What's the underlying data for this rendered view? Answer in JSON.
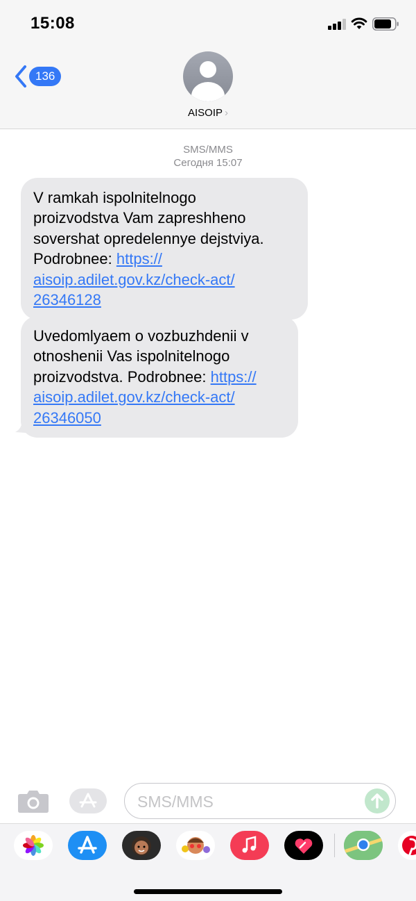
{
  "status_bar": {
    "time": "15:08",
    "icons": [
      "cellular-signal-icon",
      "wifi-icon",
      "battery-icon"
    ]
  },
  "header": {
    "back_badge": "136",
    "contact_name": "AISOIP",
    "icons": [
      "back-chevron-icon",
      "contact-avatar-icon",
      "chevron-right-icon"
    ]
  },
  "conversation": {
    "service_label": "SMS/MMS",
    "timestamp": "Сегодня 15:07"
  },
  "messages": [
    {
      "lines": [
        "V ramkah ispolnitelnogo",
        "proizvodstva Vam zapreshheno",
        "sovershat opredelennye dejstviya.",
        "Podrobnee: "
      ],
      "link_parts": [
        "https://",
        "aisoip.adilet.gov.kz/check-act/",
        "26346128"
      ]
    },
    {
      "lines": [
        "Uvedomlyaem o vozbuzhdenii v",
        "otnoshenii Vas ispolnitelnogo",
        "proizvodstva. Podrobnee: "
      ],
      "link_parts": [
        "https://",
        "aisoip.adilet.gov.kz/check-act/",
        "26346050"
      ]
    }
  ],
  "input_bar": {
    "placeholder": "SMS/MMS",
    "icons": [
      "camera-icon",
      "app-store-icon",
      "send-arrow-icon"
    ]
  },
  "app_drawer": {
    "apps": [
      "photos-icon",
      "app-store-icon",
      "memoji-icon",
      "animoji-stickers-icon",
      "music-icon",
      "digital-touch-icon",
      "maps-icon",
      "pinterest-icon"
    ]
  },
  "colors": {
    "accent": "#3478f6",
    "bubble": "#e9e9eb",
    "meta_text": "#8a8a8e",
    "send_disabled": "#c1e7cc",
    "header_bg": "#f6f6f6"
  }
}
